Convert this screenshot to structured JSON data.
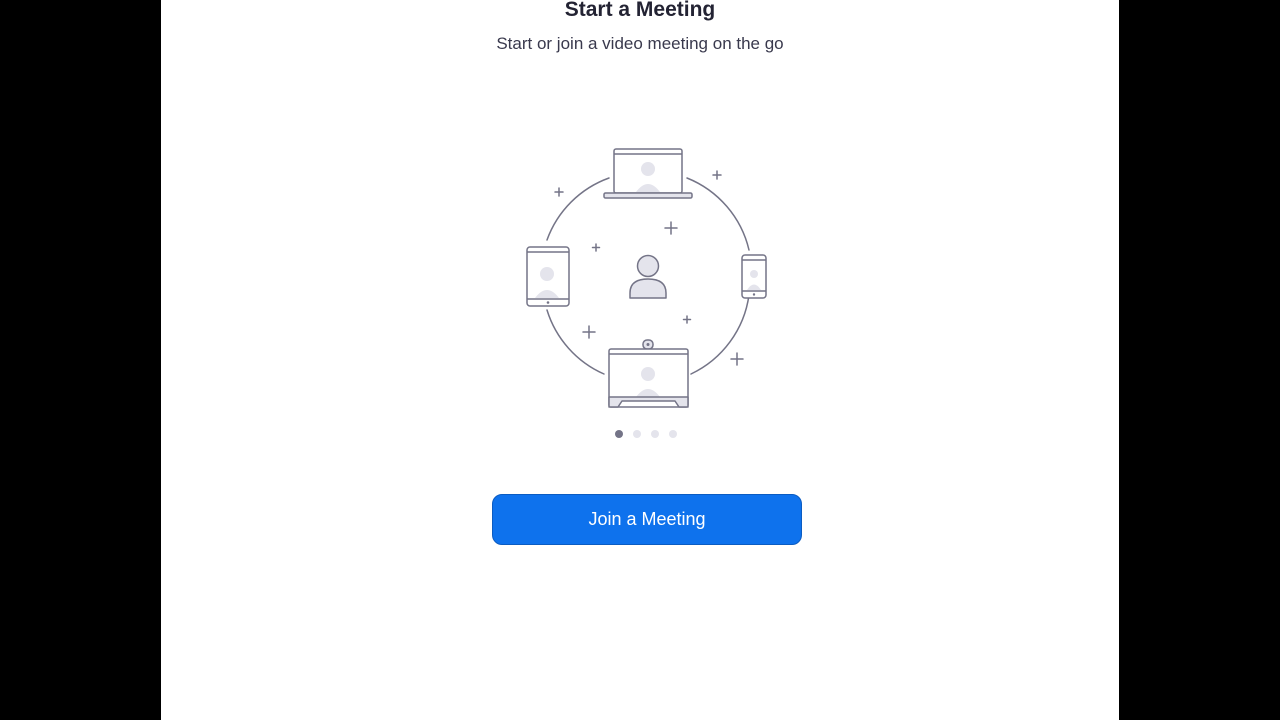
{
  "onboarding": {
    "title": "Start a Meeting",
    "subtitle": "Start or join a video meeting on the go",
    "illustration_icons": [
      "laptop-icon",
      "tablet-icon",
      "phone-icon",
      "room-system-icon",
      "person-icon"
    ],
    "page_indicator": {
      "total": 4,
      "current": 1
    },
    "join_button_label": "Join a Meeting"
  },
  "colors": {
    "background": "#ffffff",
    "title_text": "#232333",
    "subtitle_text": "#39394d",
    "primary_button": "#0e72ed",
    "button_text": "#ffffff",
    "illustration_stroke": "#747487",
    "illustration_fill": "#e4e4ec",
    "dot_active": "#747487",
    "dot_inactive": "#e4e4ec"
  }
}
